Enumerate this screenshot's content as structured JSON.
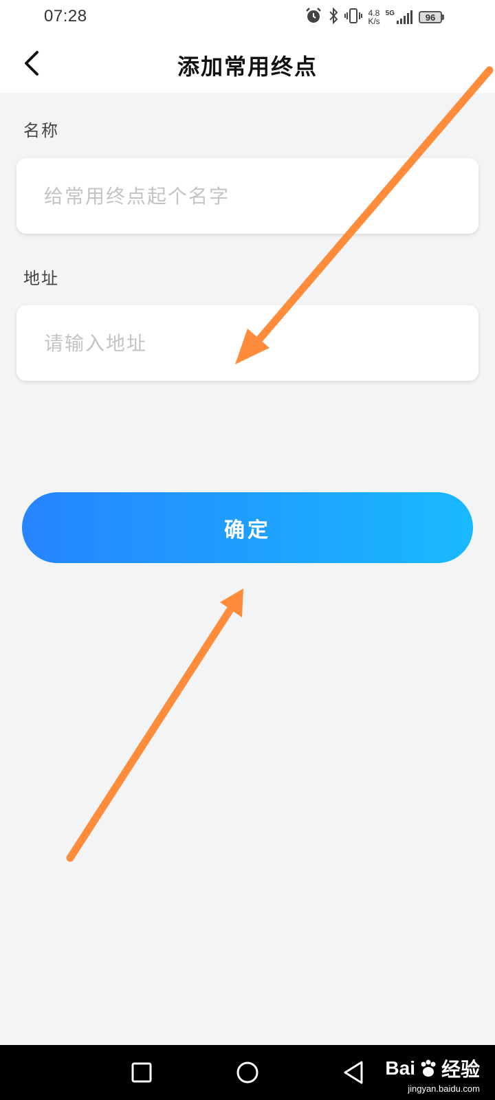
{
  "status_bar": {
    "time": "07:28",
    "speed_value": "4.8",
    "speed_unit": "K/s",
    "network": "5G",
    "battery": "96",
    "icons": [
      "alarm-icon",
      "bluetooth-icon",
      "vibrate-icon",
      "signal-icon",
      "battery-icon"
    ]
  },
  "header": {
    "title": "添加常用终点"
  },
  "form": {
    "name_label": "名称",
    "name_placeholder": "给常用终点起个名字",
    "address_label": "地址",
    "address_placeholder": "请输入地址"
  },
  "confirm_button": {
    "label": "确定"
  },
  "colors": {
    "background": "#f3f4f6",
    "button_gradient_start": "#2684ff",
    "button_gradient_end": "#19b9ff",
    "annotation_arrow": "#ff8c3a"
  },
  "watermark": {
    "brand_left": "Bai",
    "brand_right": "经验",
    "url": "jingyan.baidu.com"
  }
}
